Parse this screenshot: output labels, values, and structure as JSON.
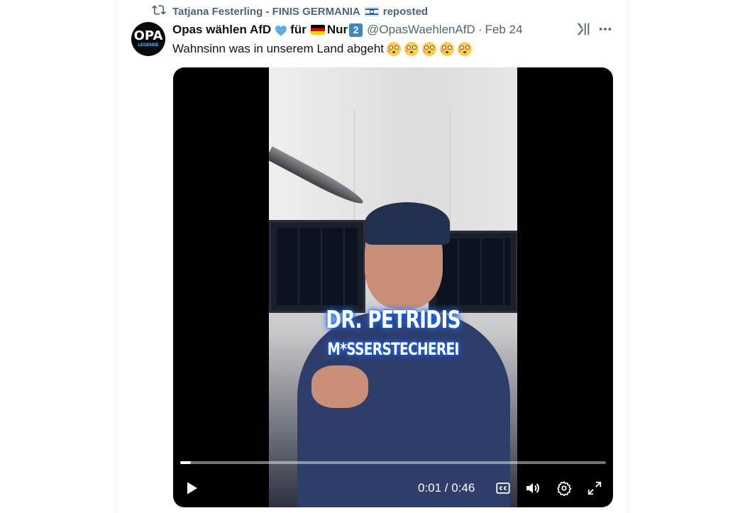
{
  "repost": {
    "user": "Tatjana Festerling - FINIS GERMANIA",
    "action": "reposted"
  },
  "tweet": {
    "avatar_text": "OPA",
    "avatar_subtext": "LEGENDE",
    "author_name_a": "Opas wählen AfD",
    "author_name_b": "für",
    "author_name_c": "Nur",
    "keycap": "2",
    "handle": "@OpasWaehlenAfD",
    "separator": "·",
    "date": "Feb 24",
    "text": "Wahnsinn was in unserem Land abgeht",
    "emoji_count": 5
  },
  "video": {
    "overlay_line1": "DR. PETRIDIS",
    "overlay_line2": "M*SSERSTECHEREI",
    "current_time": "0:01",
    "duration": "0:46",
    "time_display": "0:01 / 0:46",
    "progress_fraction": 0.025
  },
  "icons": [
    "repost-icon",
    "blue-heart-icon",
    "german-flag-icon",
    "israel-flag-icon",
    "grok-icon",
    "more-icon",
    "play-icon",
    "captions-icon",
    "volume-icon",
    "settings-icon",
    "fullscreen-icon"
  ],
  "colors": {
    "secondary_text": "#536471",
    "heart": "#5dadec",
    "video_bg": "#000000"
  }
}
